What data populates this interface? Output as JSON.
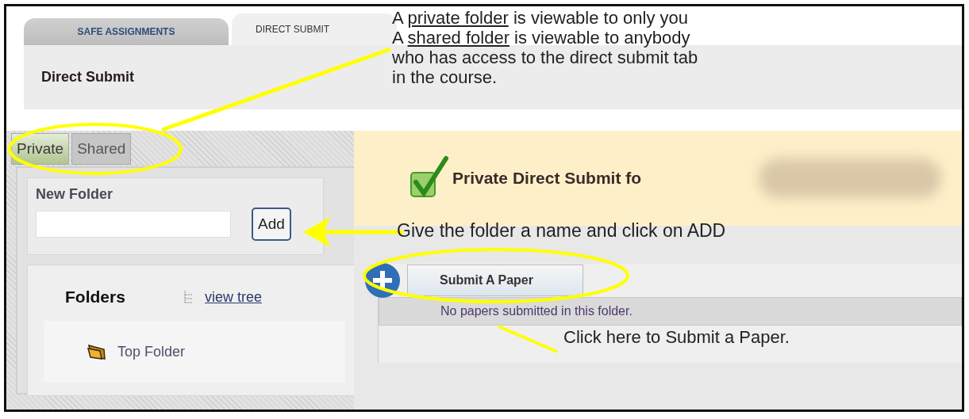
{
  "tabs": [
    {
      "label": "SAFE ASSIGNMENTS",
      "selected": false
    },
    {
      "label": "DIRECT SUBMIT",
      "selected": true
    }
  ],
  "page_title": "Direct Submit",
  "folder_tabs": [
    {
      "label": "Private",
      "selected": true
    },
    {
      "label": "Shared",
      "selected": false
    }
  ],
  "new_folder": {
    "label": "New Folder",
    "button": "Add"
  },
  "folders": {
    "title": "Folders",
    "view_tree_link": "view tree",
    "items": [
      {
        "label": "Top Folder"
      }
    ]
  },
  "main": {
    "heading": "Private Direct Submit fo",
    "submit_button": "Submit A Paper",
    "empty_message": "No papers submitted in this folder."
  },
  "annotations": [
    {
      "kind": "paragraph",
      "lines": [
        [
          {
            "text": "A "
          },
          {
            "text": "private folder",
            "underline": true
          },
          {
            "text": " is viewable to only you"
          }
        ],
        [
          {
            "text": "A "
          },
          {
            "text": "shared folder",
            "underline": true
          },
          {
            "text": " is viewable to anybody"
          }
        ],
        [
          {
            "text": "who has access to the direct submit tab"
          }
        ],
        [
          {
            "text": "in the course."
          }
        ]
      ]
    },
    {
      "kind": "callout",
      "text": "Give the folder a name and click on ADD"
    },
    {
      "kind": "callout",
      "text": "Click here to Submit a Paper."
    }
  ]
}
